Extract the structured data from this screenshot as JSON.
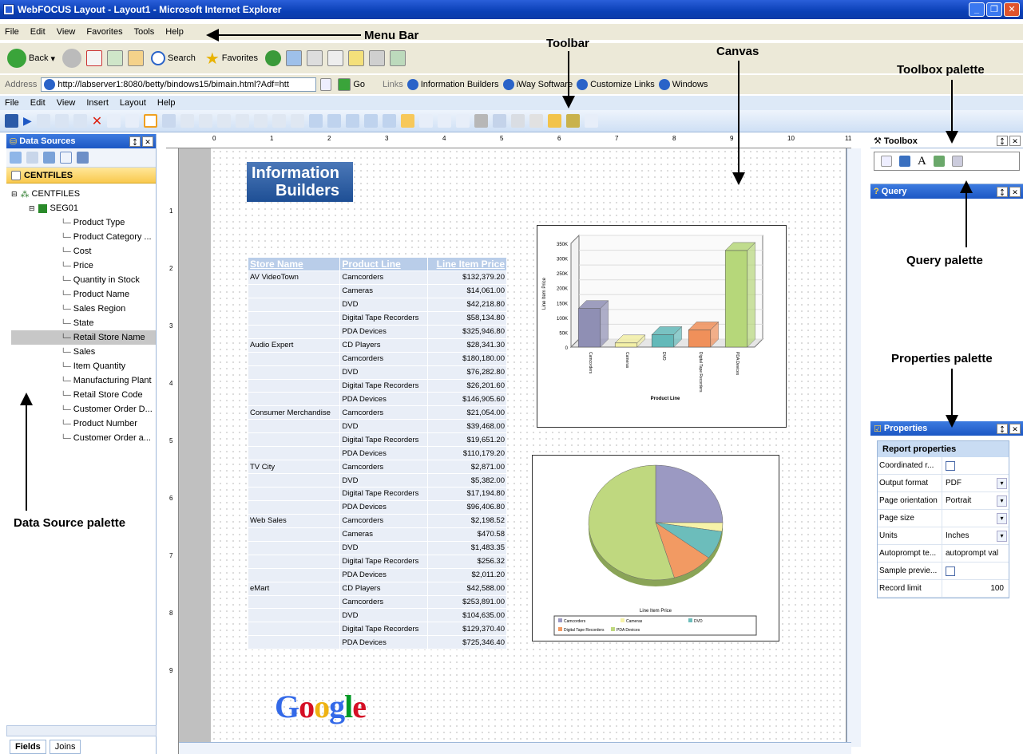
{
  "window": {
    "title": "WebFOCUS Layout - Layout1 - Microsoft Internet Explorer"
  },
  "ie_menu": [
    "File",
    "Edit",
    "View",
    "Favorites",
    "Tools",
    "Help"
  ],
  "ie_toolbar": {
    "back": "Back",
    "search": "Search",
    "favorites": "Favorites"
  },
  "address": {
    "label": "Address",
    "url": "http://labserver1:8080/betty/bindows15/bimain.html?Adf=htt",
    "go": "Go",
    "links_label": "Links",
    "links": [
      "Information Builders",
      "iWay Software",
      "Customize Links",
      "Windows"
    ]
  },
  "app_menu": [
    "File",
    "Edit",
    "View",
    "Insert",
    "Layout",
    "Help"
  ],
  "data_sources": {
    "title": "Data Sources",
    "tab": "CENTFILES",
    "root": "CENTFILES",
    "segment": "SEG01",
    "fields": [
      "Product Type",
      "Product Category ...",
      "Cost",
      "Price",
      "Quantity in Stock",
      "Product Name",
      "Sales Region",
      "State",
      "Retail Store Name",
      "Sales",
      "Item Quantity",
      "Manufacturing Plant",
      "Retail Store Code",
      "Customer Order D...",
      "Product Number",
      "Customer Order a..."
    ],
    "selected": "Retail Store Name",
    "bottom_tabs": [
      "Fields",
      "Joins"
    ]
  },
  "ruler": [
    "0",
    "1",
    "2",
    "3",
    "4",
    "5",
    "6",
    "7",
    "8",
    "9",
    "10",
    "11"
  ],
  "ruler_v": [
    "1",
    "2",
    "3",
    "4",
    "5",
    "6",
    "7",
    "8",
    "9"
  ],
  "logo": {
    "line1": "Information",
    "line2": "Builders"
  },
  "report": {
    "headers": [
      "Store Name",
      "Product Line",
      "Line Item Price"
    ],
    "rows": [
      [
        "AV VideoTown",
        "Camcorders",
        "$132,379.20"
      ],
      [
        "",
        "Cameras",
        "$14,061.00"
      ],
      [
        "",
        "DVD",
        "$42,218.80"
      ],
      [
        "",
        "Digital Tape Recorders",
        "$58,134.80"
      ],
      [
        "",
        "PDA Devices",
        "$325,946.80"
      ],
      [
        "Audio Expert",
        "CD Players",
        "$28,341.30"
      ],
      [
        "",
        "Camcorders",
        "$180,180.00"
      ],
      [
        "",
        "DVD",
        "$76,282.80"
      ],
      [
        "",
        "Digital Tape Recorders",
        "$26,201.60"
      ],
      [
        "",
        "PDA Devices",
        "$146,905.60"
      ],
      [
        "Consumer Merchandise",
        "Camcorders",
        "$21,054.00"
      ],
      [
        "",
        "DVD",
        "$39,468.00"
      ],
      [
        "",
        "Digital Tape Recorders",
        "$19,651.20"
      ],
      [
        "",
        "PDA Devices",
        "$110,179.20"
      ],
      [
        "TV City",
        "Camcorders",
        "$2,871.00"
      ],
      [
        "",
        "DVD",
        "$5,382.00"
      ],
      [
        "",
        "Digital Tape Recorders",
        "$17,194.80"
      ],
      [
        "",
        "PDA Devices",
        "$96,406.80"
      ],
      [
        "Web Sales",
        "Camcorders",
        "$2,198.52"
      ],
      [
        "",
        "Cameras",
        "$470.58"
      ],
      [
        "",
        "DVD",
        "$1,483.35"
      ],
      [
        "",
        "Digital Tape Recorders",
        "$256.32"
      ],
      [
        "",
        "PDA Devices",
        "$2,011.20"
      ],
      [
        "eMart",
        "CD Players",
        "$42,588.00"
      ],
      [
        "",
        "Camcorders",
        "$253,891.00"
      ],
      [
        "",
        "DVD",
        "$104,635.00"
      ],
      [
        "",
        "Digital Tape Recorders",
        "$129,370.40"
      ],
      [
        "",
        "PDA Devices",
        "$725,346.40"
      ]
    ]
  },
  "chart_data": [
    {
      "type": "bar",
      "xlabel": "Product Line",
      "ylabel": "Line Item Price",
      "yticks": [
        "0",
        "50K",
        "100K",
        "150K",
        "200K",
        "250K",
        "300K",
        "350K"
      ],
      "ylim": [
        0,
        350000
      ],
      "categories": [
        "Camcorders",
        "Cameras",
        "DVD",
        "Digital Tape Recorders",
        "PDA Devices"
      ],
      "values": [
        130000,
        14000,
        42000,
        58000,
        326000
      ],
      "colors": [
        "#8f8fb4",
        "#f2efa6",
        "#63b9b9",
        "#f0905a",
        "#b6d77a"
      ]
    },
    {
      "type": "pie",
      "title": "Line Item Price",
      "categories": [
        "Camcorders",
        "Cameras",
        "DVD",
        "Digital Tape Recorders",
        "PDA Devices"
      ],
      "values": [
        25,
        2.5,
        8,
        10,
        54.5
      ],
      "colors": [
        "#9b99c2",
        "#f7f3a8",
        "#6cbdbb",
        "#f29a63",
        "#bfd87f"
      ],
      "legend_position": "bottom"
    }
  ],
  "google": {
    "text": "Google"
  },
  "toolbox": {
    "title": "Toolbox"
  },
  "query": {
    "title": "Query"
  },
  "properties": {
    "title": "Properties",
    "section": "Report properties",
    "rows": [
      {
        "key": "Coordinated r...",
        "value": "",
        "kind": "checkbox"
      },
      {
        "key": "Output format",
        "value": "PDF",
        "kind": "dropdown"
      },
      {
        "key": "Page orientation",
        "value": "Portrait",
        "kind": "dropdown"
      },
      {
        "key": "Page size",
        "value": "",
        "kind": "dropdown"
      },
      {
        "key": "Units",
        "value": "Inches",
        "kind": "dropdown"
      },
      {
        "key": "Autoprompt te...",
        "value": "autoprompt val",
        "kind": "text"
      },
      {
        "key": "Sample previe...",
        "value": "",
        "kind": "checkbox"
      },
      {
        "key": "Record limit",
        "value": "100",
        "kind": "number"
      }
    ]
  },
  "annotations": {
    "menu_bar": "Menu Bar",
    "toolbar": "Toolbar",
    "canvas": "Canvas",
    "toolbox_palette": "Toolbox palette",
    "query_palette": "Query palette",
    "properties_palette": "Properties palette",
    "data_source_palette": "Data Source palette"
  }
}
